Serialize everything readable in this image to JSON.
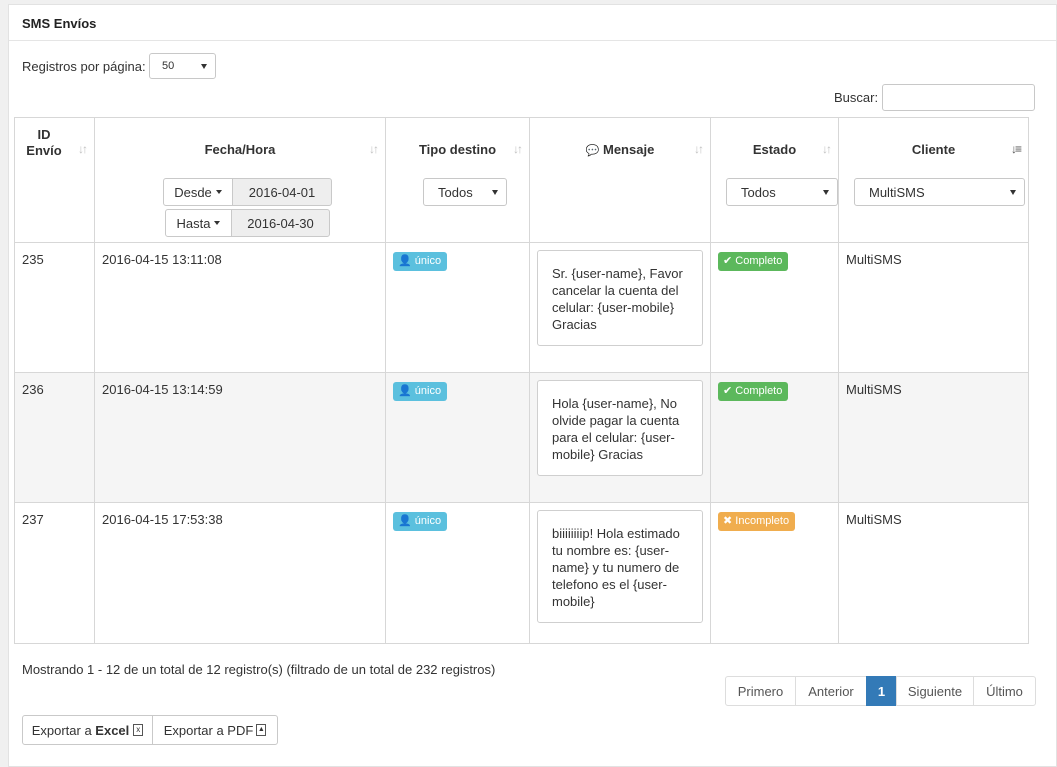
{
  "panel": {
    "title": "SMS Envíos"
  },
  "controls": {
    "per_page_label": "Registros por página:",
    "per_page_value": "50",
    "search_label": "Buscar:",
    "search_value": ""
  },
  "table": {
    "headers": {
      "id": "ID Envío",
      "fecha": "Fecha/Hora",
      "tipo": "Tipo destino",
      "mensaje": "Mensaje",
      "estado": "Estado",
      "cliente": "Cliente"
    },
    "filters": {
      "desde_label": "Desde",
      "desde_value": "2016-04-01",
      "hasta_label": "Hasta",
      "hasta_value": "2016-04-30",
      "tipo_value": "Todos",
      "estado_value": "Todos",
      "cliente_value": "MultiSMS"
    },
    "rows": [
      {
        "id": "235",
        "fecha": "2016-04-15 13:11:08",
        "tipo": "único",
        "mensaje": "Sr. {user-name}, Favor cancelar la cuenta del celular: {user-mobile} Gracias",
        "estado": "Completo",
        "cliente": "MultiSMS"
      },
      {
        "id": "236",
        "fecha": "2016-04-15 13:14:59",
        "tipo": "único",
        "mensaje": "Hola {user-name}, No olvide pagar la cuenta para el celular: {user-mobile} Gracias",
        "estado": "Completo",
        "cliente": "MultiSMS"
      },
      {
        "id": "237",
        "fecha": "2016-04-15 17:53:38",
        "tipo": "único",
        "mensaje": "biiiiiiiip! Hola estimado tu nombre es: {user-name} y tu numero de telefono es el {user-mobile}",
        "estado": "Incompleto",
        "cliente": "MultiSMS"
      }
    ]
  },
  "footer": {
    "info": "Mostrando 1 - 12 de un total de 12 registro(s) (filtrado de un total de 232 registros)",
    "pagination": {
      "first": "Primero",
      "prev": "Anterior",
      "current": "1",
      "next": "Siguiente",
      "last": "Último"
    },
    "export_excel_prefix": "Exportar a ",
    "export_excel_bold": "Excel",
    "export_pdf": "Exportar a PDF"
  },
  "colors": {
    "info": "#5bc0de",
    "success": "#5cb85c",
    "warning": "#f0ad4e",
    "primary": "#337ab7"
  }
}
